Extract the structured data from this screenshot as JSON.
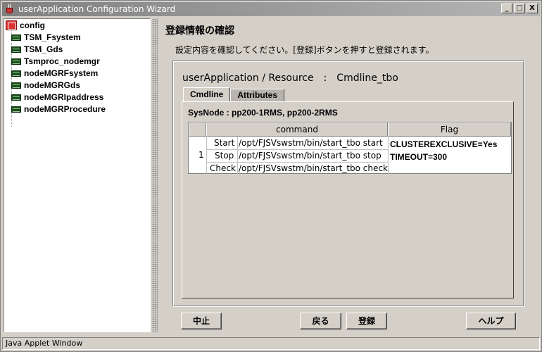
{
  "window": {
    "title": "userApplication Configuration Wizard",
    "minimize": "_",
    "maximize": "□",
    "close": "X"
  },
  "tree": {
    "root": "config",
    "items": [
      "TSM_Fsystem",
      "TSM_Gds",
      "Tsmproc_nodemgr",
      "nodeMGRFsystem",
      "nodeMGRGds",
      "nodeMGRIpaddress",
      "nodeMGRProcedure"
    ]
  },
  "main": {
    "title": "登録情報の確認",
    "instruction": "設定内容を確認してください。[登録]ボタンを押すと登録されます。",
    "resource_title": "userApplication / Resource　:　Cmdline_tbo",
    "tabs": [
      "Cmdline",
      "Attributes"
    ],
    "sysnode": "SysNode : pp200-1RMS, pp200-2RMS",
    "table": {
      "headers": [
        "",
        "command",
        "Flag"
      ],
      "row_number": "1",
      "rows": [
        {
          "type": "Start",
          "command": "/opt/FJSVswstm/bin/start_tbo start"
        },
        {
          "type": "Stop",
          "command": "/opt/FJSVswstm/bin/start_tbo stop"
        },
        {
          "type": "Check",
          "command": "/opt/FJSVswstm/bin/start_tbo check"
        }
      ],
      "flags": [
        "CLUSTEREXCLUSIVE=Yes",
        "TIMEOUT=300"
      ]
    }
  },
  "buttons": {
    "cancel": "中止",
    "back": "戻る",
    "register": "登録",
    "help": "ヘルプ"
  },
  "status": "Java Applet Window"
}
